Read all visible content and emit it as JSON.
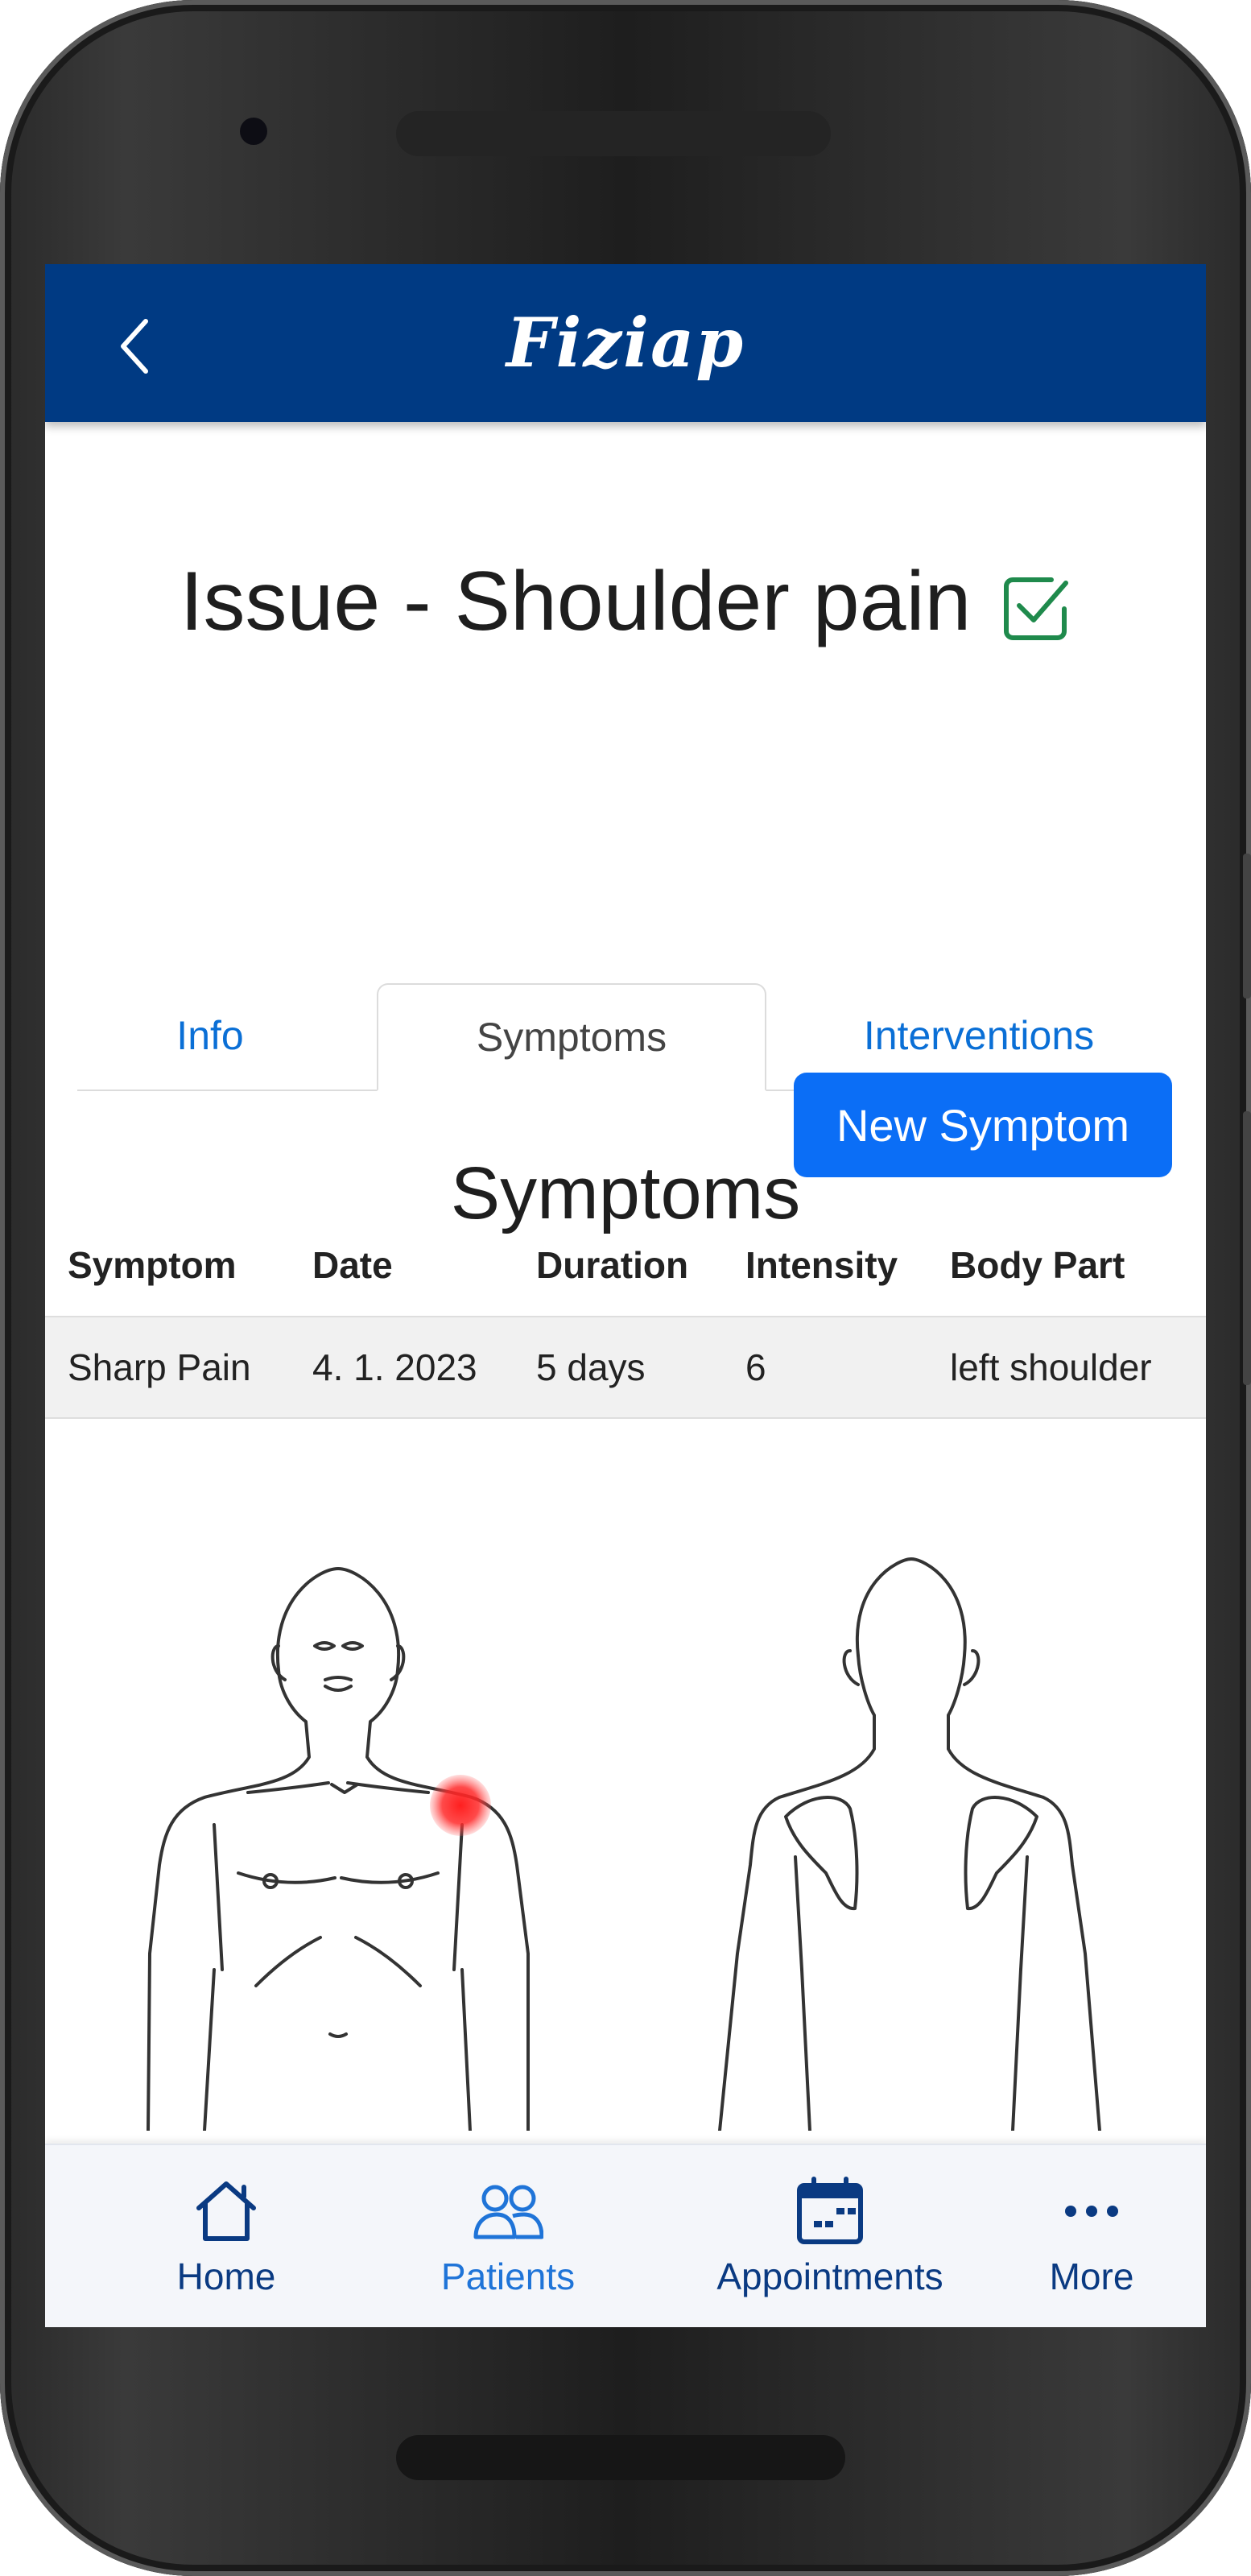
{
  "app": {
    "logo_text": "Fiziap"
  },
  "header": {
    "back_icon": "chevron-left-icon"
  },
  "issue": {
    "title": "Issue - Shoulder pain",
    "status_icon": "checkbox-checked-icon",
    "status_color": "#1f8a4c"
  },
  "tabs": [
    {
      "label": "Info",
      "active": false
    },
    {
      "label": "Symptoms",
      "active": true
    },
    {
      "label": "Interventions",
      "active": false
    }
  ],
  "section": {
    "title": "Symptoms",
    "new_button_label": "New Symptom"
  },
  "table": {
    "headers": [
      "Symptom",
      "Date",
      "Duration",
      "Intensity",
      "Body Part"
    ],
    "rows": [
      [
        "Sharp Pain",
        "4. 1. 2023",
        "5 days",
        "6",
        "left shoulder"
      ]
    ]
  },
  "body_map": {
    "marker": "left shoulder",
    "marker_color": "#ff2a2a"
  },
  "bottom_nav": [
    {
      "label": "Home",
      "icon": "home-icon",
      "active": false
    },
    {
      "label": "Patients",
      "icon": "users-icon",
      "active": true
    },
    {
      "label": "Appointments",
      "icon": "calendar-icon",
      "active": false
    },
    {
      "label": "More",
      "icon": "more-dots-icon",
      "active": false
    }
  ],
  "colors": {
    "header_bg": "#003a83",
    "primary_button": "#0b6ef6",
    "link": "#0a6fd6"
  }
}
